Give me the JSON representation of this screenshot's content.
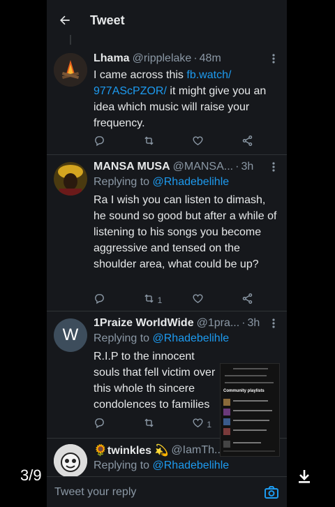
{
  "header": {
    "title": "Tweet"
  },
  "tweets": [
    {
      "name": "Lhama",
      "handle": "@ripplelake",
      "time": "48m",
      "reply_to_prefix": "",
      "reply_to_user": "",
      "body_before_link": "I came across this",
      "link": "fb.watch/ 977AScPZOR/",
      "body_after_link": "it might give you an idea which music will raise your frequency.",
      "retweets": "",
      "likes": ""
    },
    {
      "name": "MANSA MUSA",
      "handle": "@MANSA...",
      "time": "3h",
      "reply_to_prefix": "Replying to",
      "reply_to_user": "@Rhadebelihle",
      "body": "Ra I wish you can listen to dimash, he sound so good but after a while of listening to his songs you become aggressive and tensed on the shoulder area, what could be up?",
      "retweets": "1",
      "likes": ""
    },
    {
      "name": "1Praize WorldWide",
      "handle": "@1pra...",
      "time": "3h",
      "avatar_letter": "W",
      "reply_to_prefix": "Replying to",
      "reply_to_user": "@Rhadebelihle",
      "body": "R.I.P to the innocent souls that fell victim over this whole th sincere condolences to families",
      "retweets": "",
      "likes": "1"
    },
    {
      "name": "🌻twinkles 💫",
      "handle": "@IamTh...",
      "reply_to_prefix": "Replying to",
      "reply_to_user": "@Rhadebelihle"
    }
  ],
  "thumbnail": {
    "title": "Community playlists"
  },
  "reply_bar": {
    "placeholder": "Tweet your reply"
  },
  "viewer": {
    "counter": "3/9"
  },
  "colors": {
    "accent": "#1d9bf0",
    "background": "#16181c",
    "muted": "#8b98a5"
  }
}
